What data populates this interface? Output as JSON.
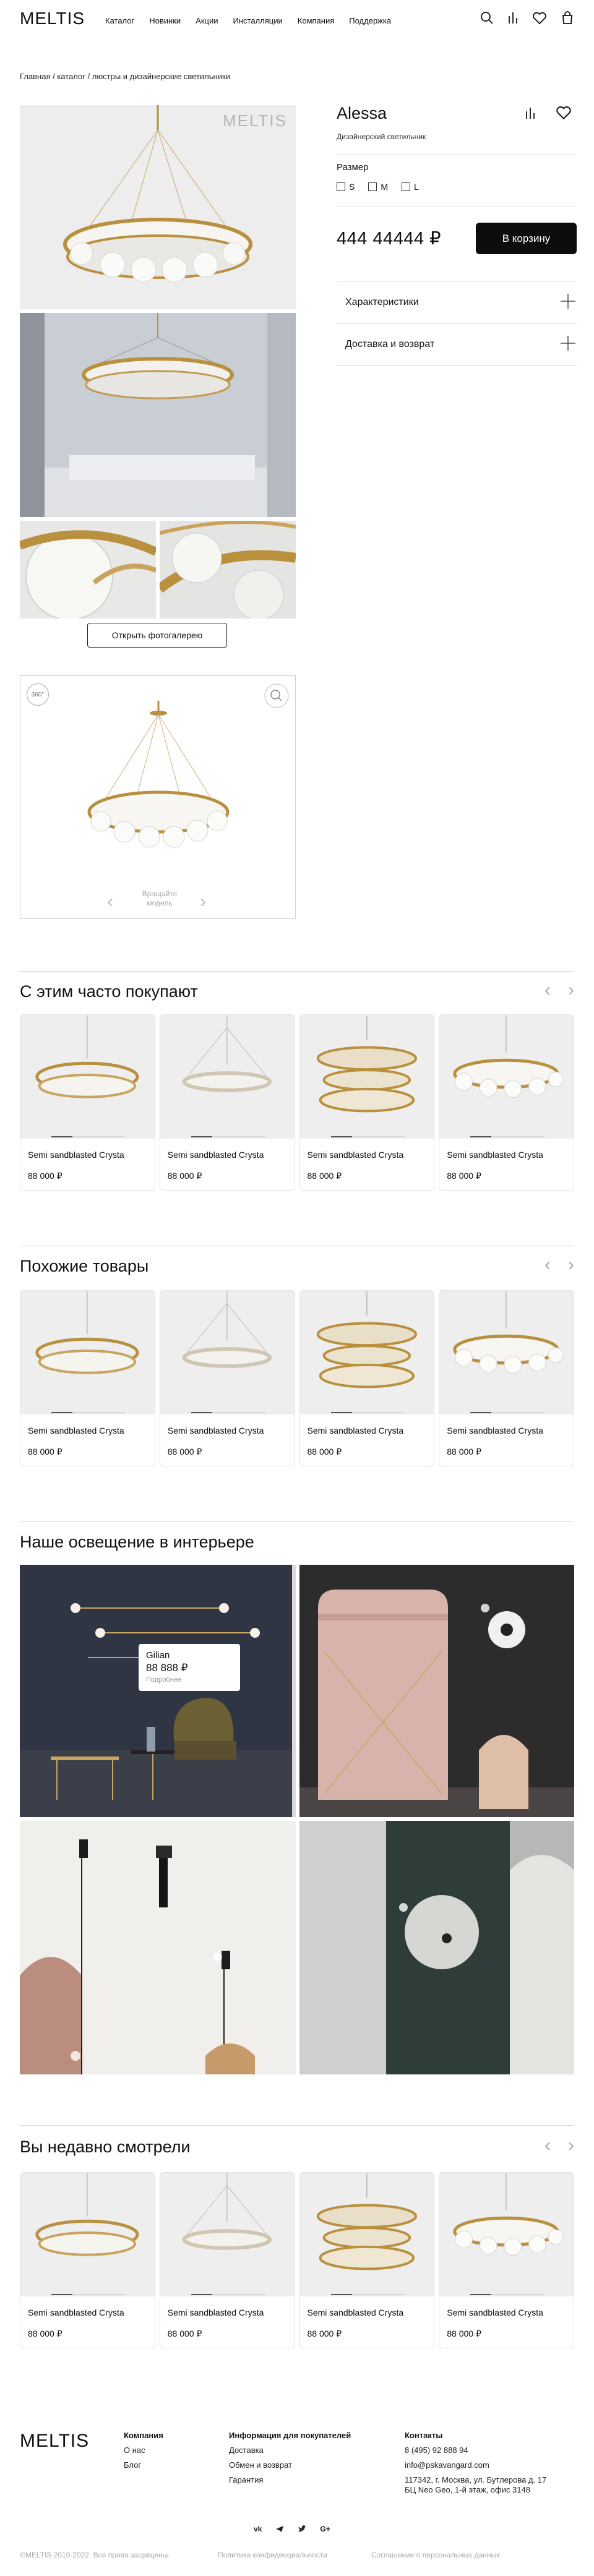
{
  "header": {
    "logo": "MELTIS",
    "nav": [
      "Каталог",
      "Новинки",
      "Акции",
      "Инсталляции",
      "Компания",
      "Поддержка"
    ]
  },
  "breadcrumb": "Главная / каталог / люстры и дизайнерские светильники",
  "gallery": {
    "watermark": "MELTIS",
    "button": "Открыть фотогалерею",
    "badge_360": "360°",
    "rotate_hint_1": "Вращайте",
    "rotate_hint_2": "модель"
  },
  "product": {
    "title": "Alessa",
    "subtitle": "Дизайнерский светильник",
    "size_label": "Размер",
    "sizes": [
      "S",
      "M",
      "L"
    ],
    "price": "444 44444 ₽",
    "cart_button": "В корзину",
    "accordion": [
      "Характеристики",
      "Доставка и возврат"
    ]
  },
  "sections": {
    "often_bought": "С этим часто покупают",
    "similar": "Похожие товары",
    "interior": "Наше освещение в интерьере",
    "recent": "Вы недавно смотрели"
  },
  "card": {
    "name": "Semi sandblasted Crysta",
    "price": "88 000 ₽"
  },
  "interior_tip": {
    "name": "Gilian",
    "price": "88 888 ₽",
    "more": "Подробнее"
  },
  "footer": {
    "logo": "MELTIS",
    "company": {
      "title": "Компания",
      "links": [
        "О нас",
        "Блог"
      ]
    },
    "buyers": {
      "title": "Информация для покупателей",
      "links": [
        "Доставка",
        "Обмен и возврат",
        "Гарантия"
      ]
    },
    "contacts": {
      "title": "Контакты",
      "phone": "8 (495) 92 888 94",
      "email": "info@pskavangard.com",
      "address_1": "117342, г. Москва, ул. Бутлерова д. 17",
      "address_2": "БЦ Neo Geo, 1-й этаж, офис 3148"
    },
    "social": [
      "vk-icon",
      "telegram-icon",
      "twitter-icon",
      "google-icon"
    ],
    "copyright": "©MELTIS 2010-2022. Все права защищены.",
    "privacy": "Политика конфиденциальности",
    "consent": "Соглашение о персональных данных"
  },
  "colors": {
    "accent": "#0d0d0d",
    "gold": "#b8903e",
    "muted": "#aaaaaa"
  }
}
